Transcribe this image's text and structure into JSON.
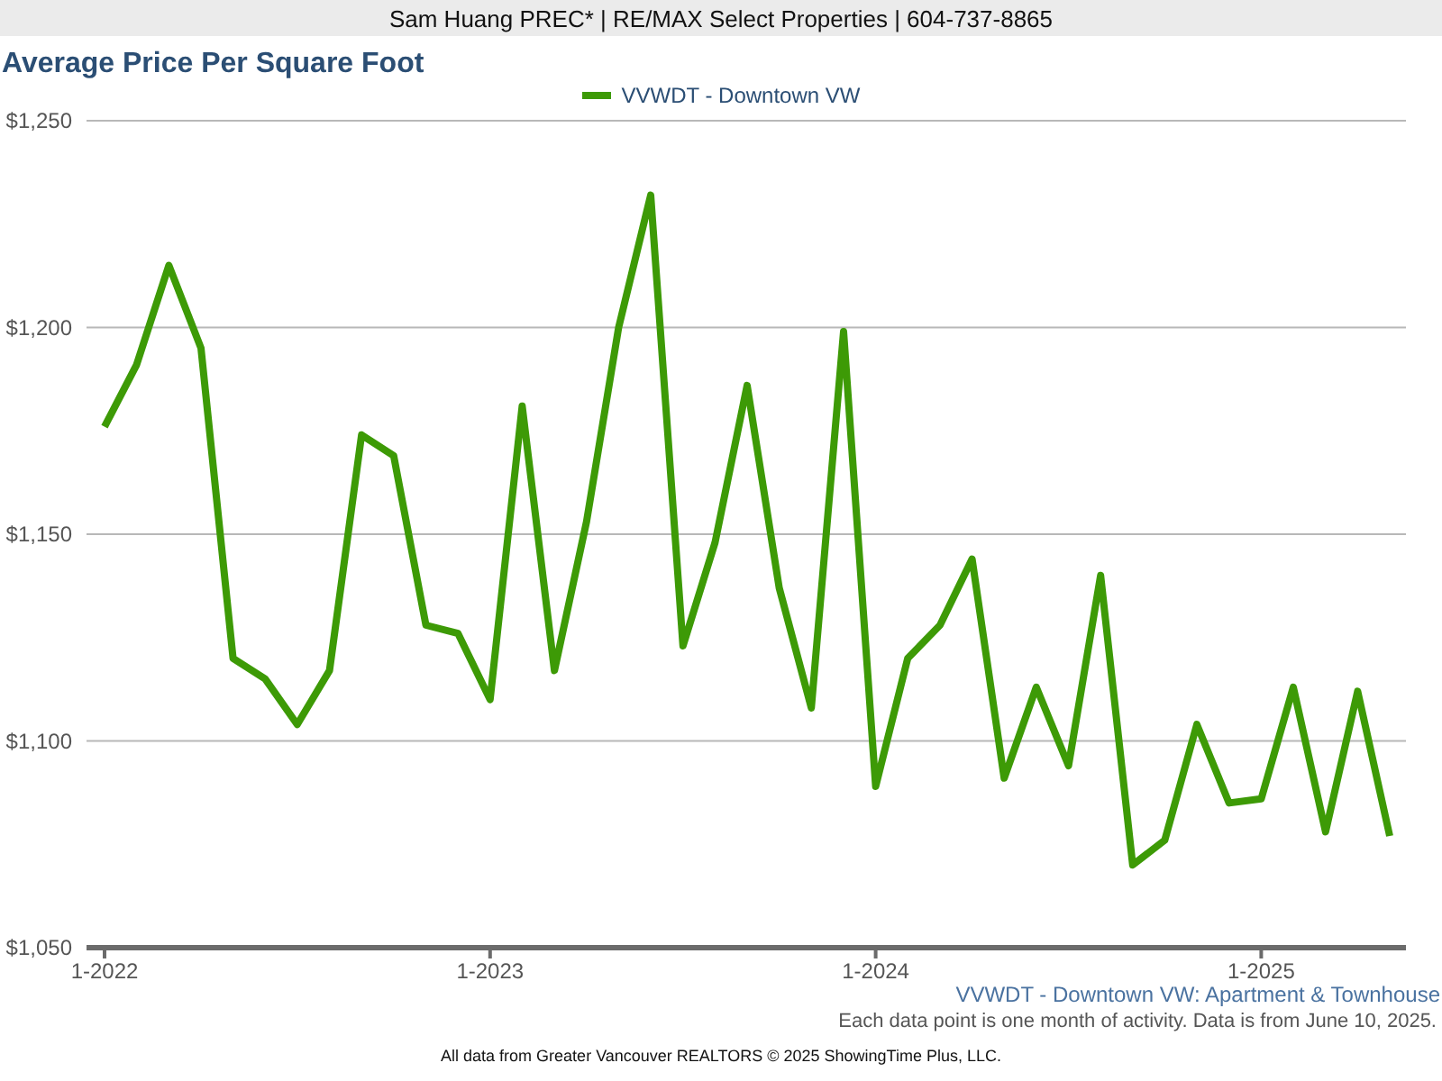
{
  "header": {
    "text": "Sam Huang PREC* | RE/MAX Select Properties | 604-737-8865"
  },
  "title": "Average Price Per Square Foot",
  "chart": {
    "chart_data": {
      "type": "line",
      "categories": [
        "1-2022",
        null,
        null,
        null,
        null,
        null,
        null,
        null,
        null,
        null,
        null,
        null,
        "1-2023",
        null,
        null,
        null,
        null,
        null,
        null,
        null,
        null,
        null,
        null,
        null,
        "1-2024",
        null,
        null,
        null,
        null,
        null,
        null,
        null,
        null,
        null,
        null,
        null,
        "1-2025",
        null,
        null,
        null,
        null
      ],
      "series": [
        {
          "name": "VVWDT - Downtown VW",
          "color": "#3d9a06",
          "values": [
            1176,
            1191,
            1215,
            1195,
            1120,
            1115,
            1104,
            1117,
            1174,
            1169,
            1128,
            1126,
            1110,
            1181,
            1117,
            1153,
            1200,
            1232,
            1123,
            1148,
            1186,
            1137,
            1108,
            1199,
            1089,
            1120,
            1128,
            1144,
            1091,
            1113,
            1094,
            1140,
            1070,
            1076,
            1104,
            1085,
            1086,
            1113,
            1078,
            1112,
            1077
          ]
        }
      ],
      "ylim": [
        1050,
        1250
      ],
      "grid": "y",
      "yticks": [
        {
          "value": 1050,
          "label": "$1,050"
        },
        {
          "value": 1100,
          "label": "$1,100"
        },
        {
          "value": 1150,
          "label": "$1,150"
        },
        {
          "value": 1200,
          "label": "$1,200"
        },
        {
          "value": 1250,
          "label": "$1,250"
        }
      ]
    }
  },
  "subtitle": "VVWDT - Downtown VW: Apartment & Townhouse",
  "note": "Each data point is one month of activity. Data is from June 10, 2025.",
  "footer": "All data from Greater Vancouver REALTORS © 2025 ShowingTime Plus, LLC."
}
